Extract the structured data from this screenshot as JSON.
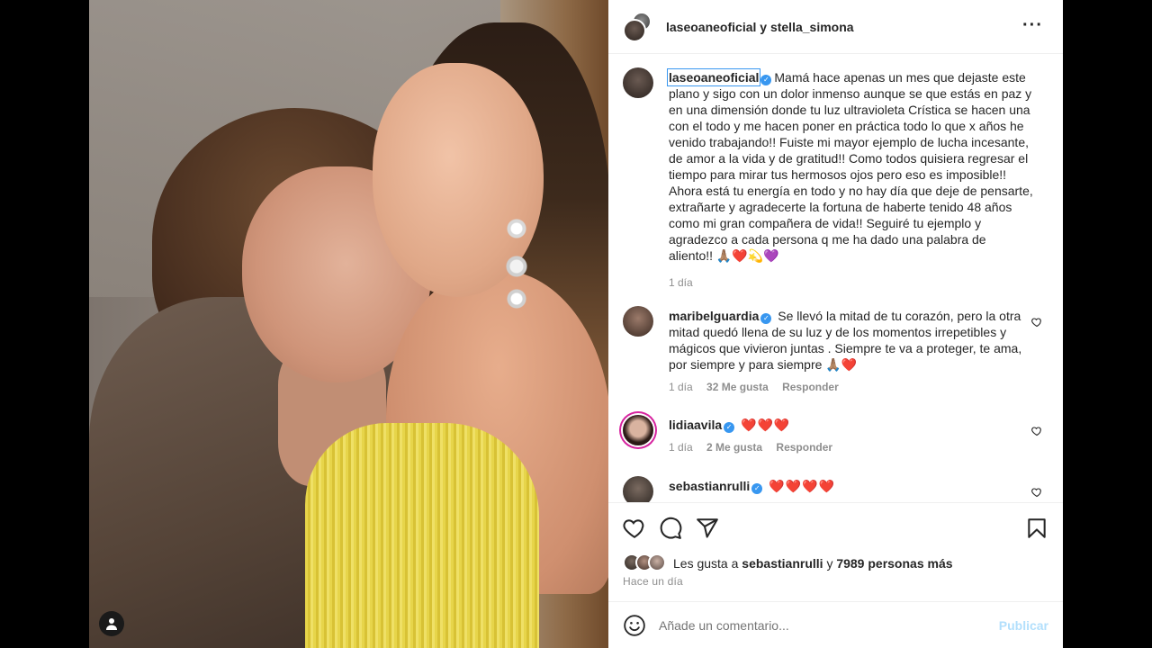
{
  "header": {
    "title": "laseoaneoficial y stella_simona",
    "more_icon": "more-horizontal-icon"
  },
  "caption": {
    "user": "laseoaneoficial",
    "text": "Mamá hace apenas un mes que dejaste este plano y sigo con un dolor inmenso aunque se que estás en paz y en una dimensión donde tu luz ultravioleta Crística se hacen una con el todo y me hacen poner en práctica todo lo que x años he venido trabajando!! Fuiste mi mayor ejemplo de lucha incesante, de amor a la vida y de gratitud!! Como todos quisiera regresar el tiempo para mirar tus hermosos ojos pero eso es imposible!! Ahora está tu energía en todo y no hay día que deje de pensarte, extrañarte y agradecerte la fortuna de haberte tenido 48 años como mi gran compañera de vida!! Seguiré tu ejemplo y agradezco a cada persona q me ha dado una palabra de aliento!! 🙏🏽❤️💫💜",
    "time": "1 día"
  },
  "comments": [
    {
      "user": "maribelguardia",
      "text": "Se llevó la mitad de tu corazón, pero la otra mitad quedó llena de su luz y de los momentos irrepetibles y mágicos que vivieron juntas . Siempre te va a proteger, te ama, por siempre y para siempre 🙏🏽❤️",
      "time": "1 día",
      "likes": "32 Me gusta",
      "reply": "Responder"
    },
    {
      "user": "lidiaavila",
      "text": "❤️❤️❤️",
      "time": "1 día",
      "likes": "2 Me gusta",
      "reply": "Responder"
    },
    {
      "user": "sebastianrulli",
      "text": "❤️❤️❤️❤️"
    }
  ],
  "likes": {
    "prefix": "Les gusta a",
    "user": "sebastianrulli",
    "middle": "y",
    "others": "7989 personas más"
  },
  "date": "Hace un día",
  "composer": {
    "placeholder": "Añade un comentario...",
    "post_label": "Publicar"
  },
  "colors": {
    "verified": "#3897f0",
    "post_disabled": "#b2dffc",
    "meta": "#8e8e8e"
  }
}
